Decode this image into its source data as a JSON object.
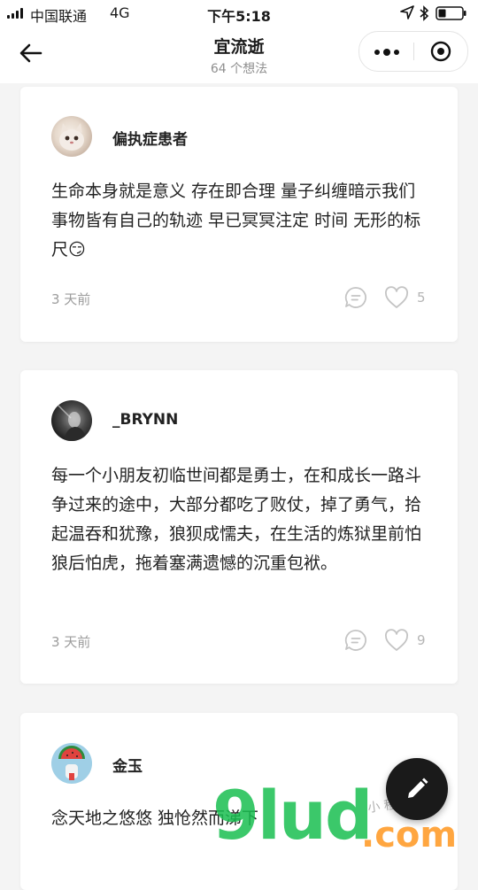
{
  "status_bar": {
    "carrier": "中国联通",
    "network": "4G",
    "time": "下午5:18"
  },
  "nav": {
    "title": "宜流逝",
    "subtitle": "64 个想法"
  },
  "posts": [
    {
      "username": "偏执症患者",
      "content": "生命本身就是意义 存在即合理 量子纠缠暗示我们 事物皆有自己的轨迹 早已冥冥注定 时间 无形的标尺😏",
      "time_ago": "3 天前",
      "likes": "5"
    },
    {
      "username": "_BRYNN",
      "content": "每一个小朋友初临世间都是勇士，在和成长一路斗争过来的途中，大部分都吃了败仗，掉了勇气，拾起温吞和犹豫，狼狈成懦夫，在生活的炼狱里前怕狼后怕虎，拖着塞满遗憾的沉重包袱。",
      "time_ago": "3 天前",
      "likes": "9"
    },
    {
      "username": "金玉",
      "content": "念天地之悠悠 独怆然而涕下"
    }
  ],
  "watermark": {
    "main": "9lud",
    "suffix": ".com",
    "script": "小 程 序 商 店"
  },
  "colors": {
    "background": "#f4f4f4",
    "card": "#ffffff",
    "fab": "#1a1a1a",
    "meta": "#9c9c9c"
  }
}
